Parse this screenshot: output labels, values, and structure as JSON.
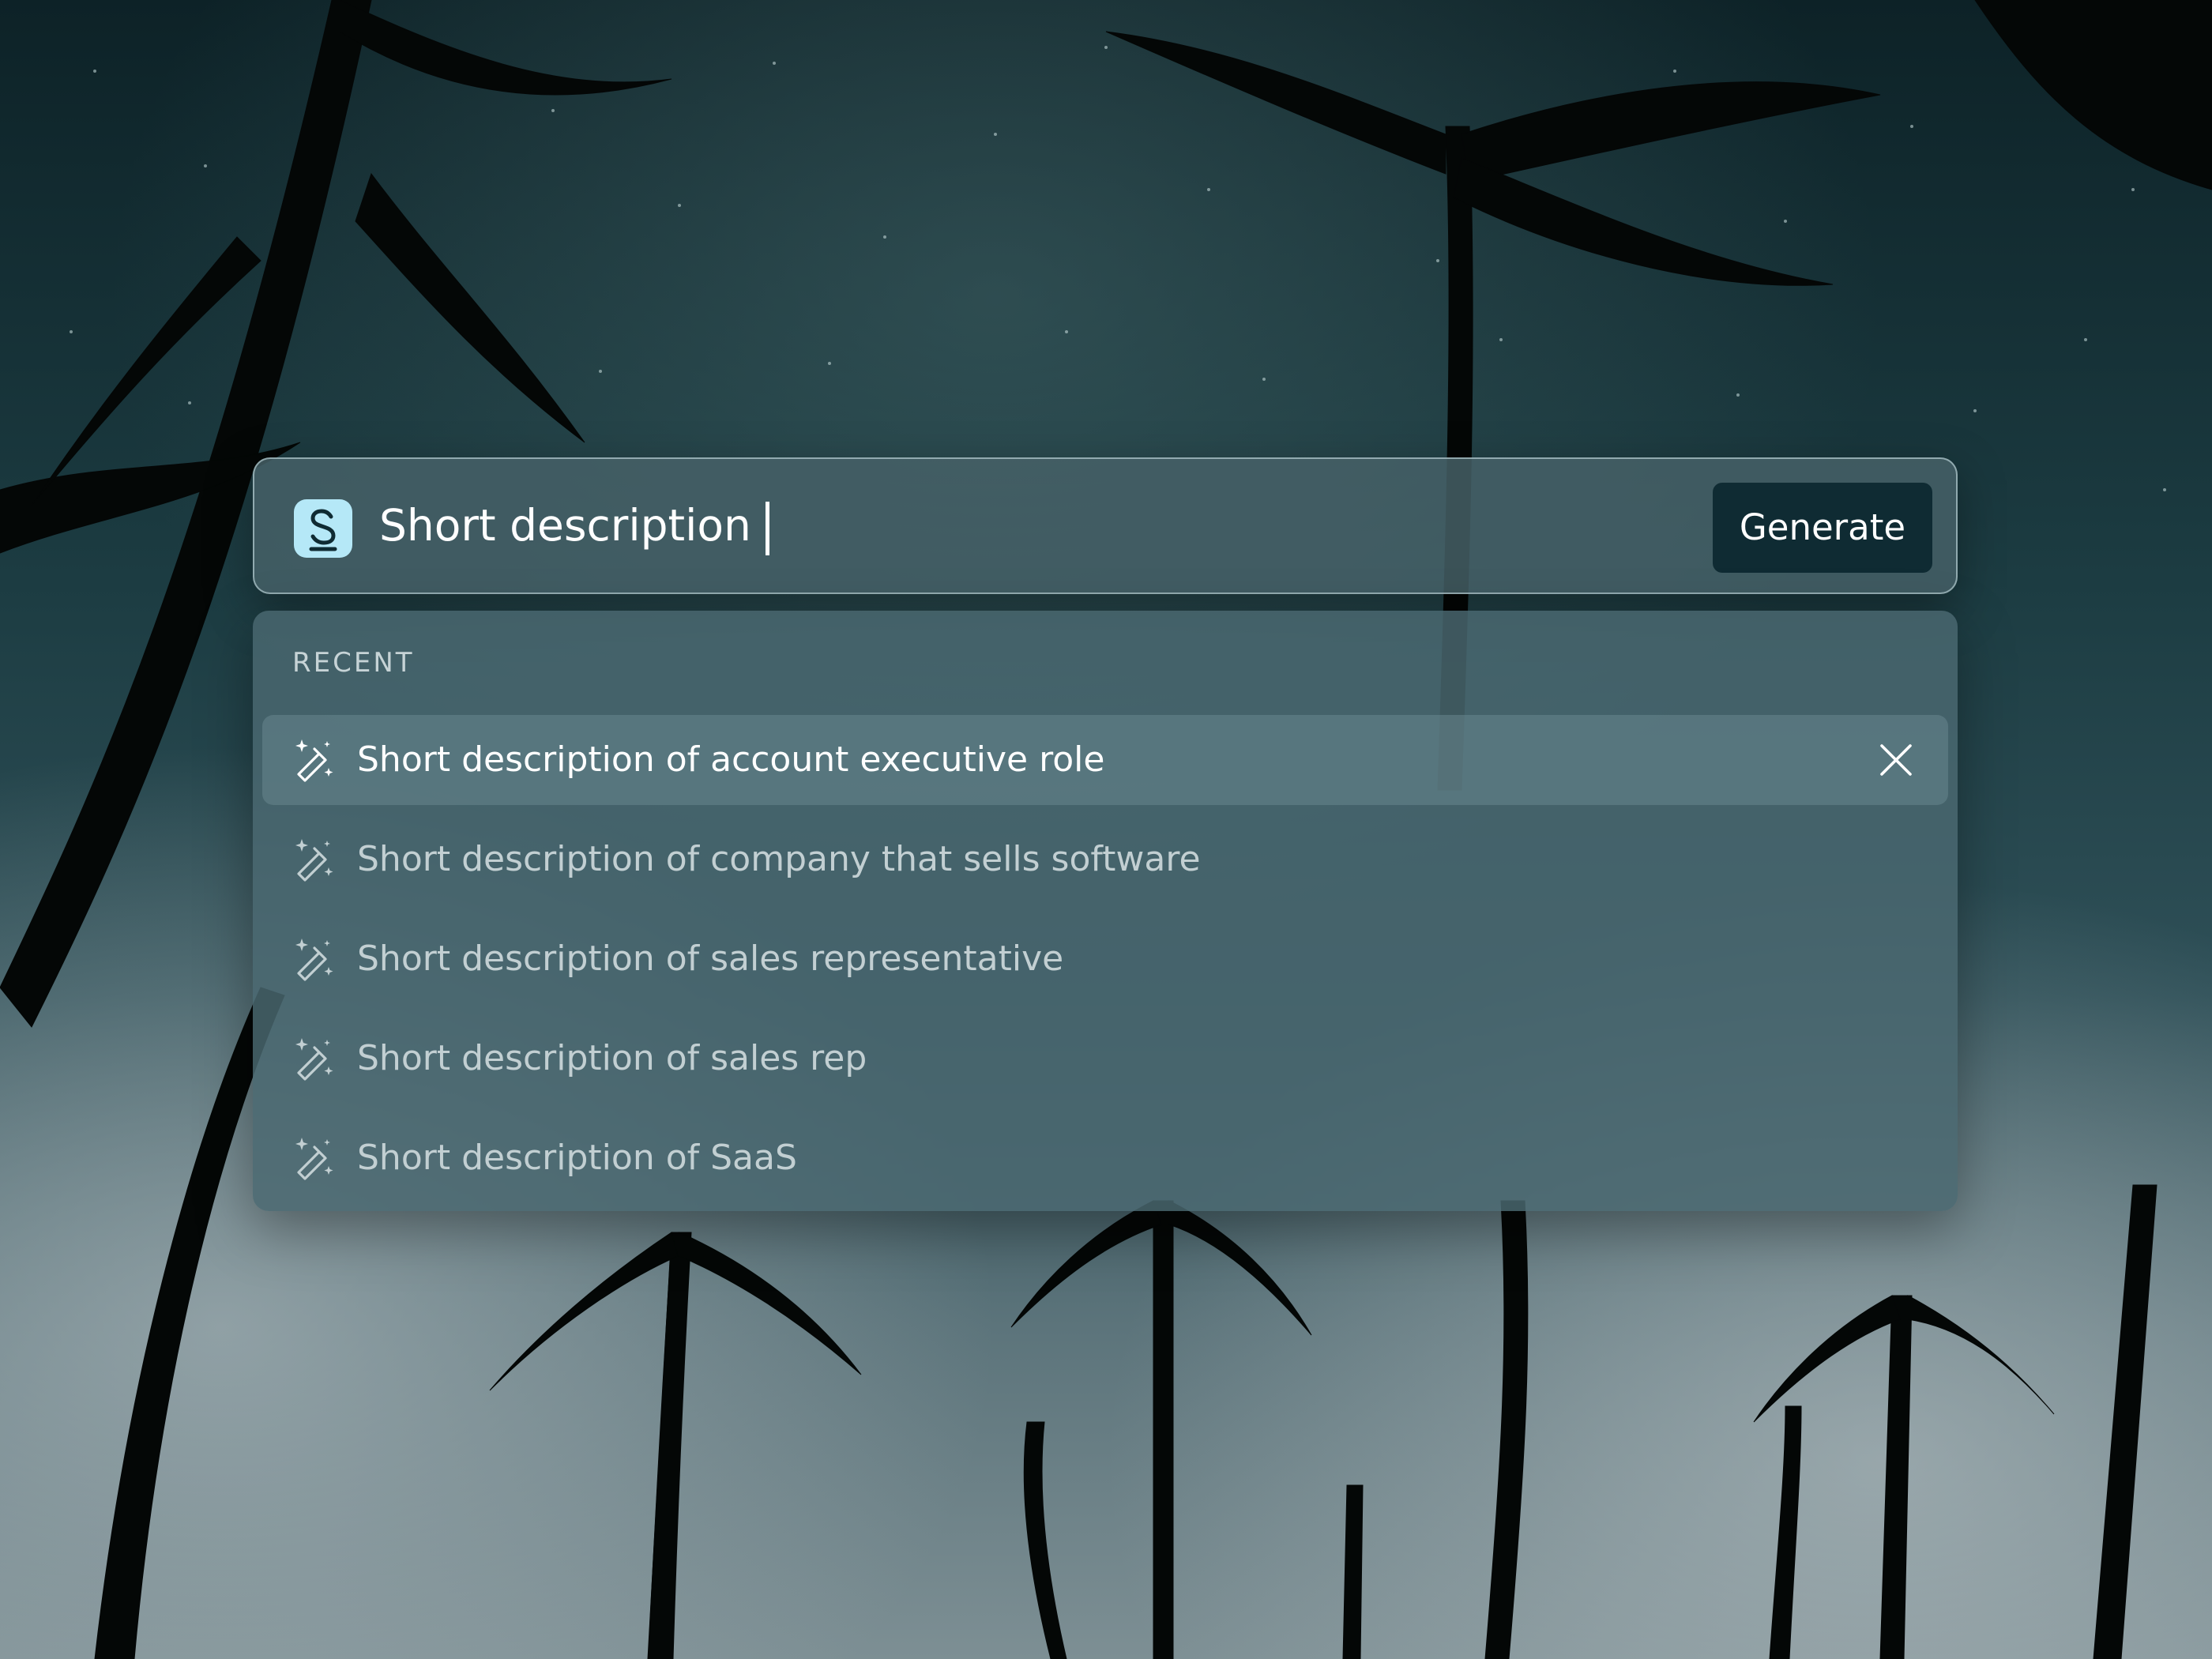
{
  "background": {
    "description_icon": "night-sky-palm-trees-photo",
    "colors": {
      "sky_top": "#0e2429",
      "sky_mid": "#1e4248",
      "horizon": "#6b8289",
      "silhouette": "#050807"
    }
  },
  "search": {
    "logo_icon": "s-logo-icon",
    "logo_color": "#b5e8f7",
    "query": "Short description",
    "generate_label": "Generate"
  },
  "recent": {
    "heading": "RECENT",
    "item_icon": "magic-wand-icon",
    "remove_icon": "close-icon",
    "items": [
      {
        "label": "Short description of account executive role",
        "highlighted": true
      },
      {
        "label": "Short description of company that sells software",
        "highlighted": false
      },
      {
        "label": "Short description of sales representative",
        "highlighted": false
      },
      {
        "label": "Short description of sales rep",
        "highlighted": false
      },
      {
        "label": "Short description of SaaS",
        "highlighted": false
      }
    ]
  },
  "theme": {
    "button_bg": "#0f2b33",
    "panel_bg": "#4a6870",
    "text_primary": "#ffffff",
    "text_muted": "#c2cfd2"
  }
}
